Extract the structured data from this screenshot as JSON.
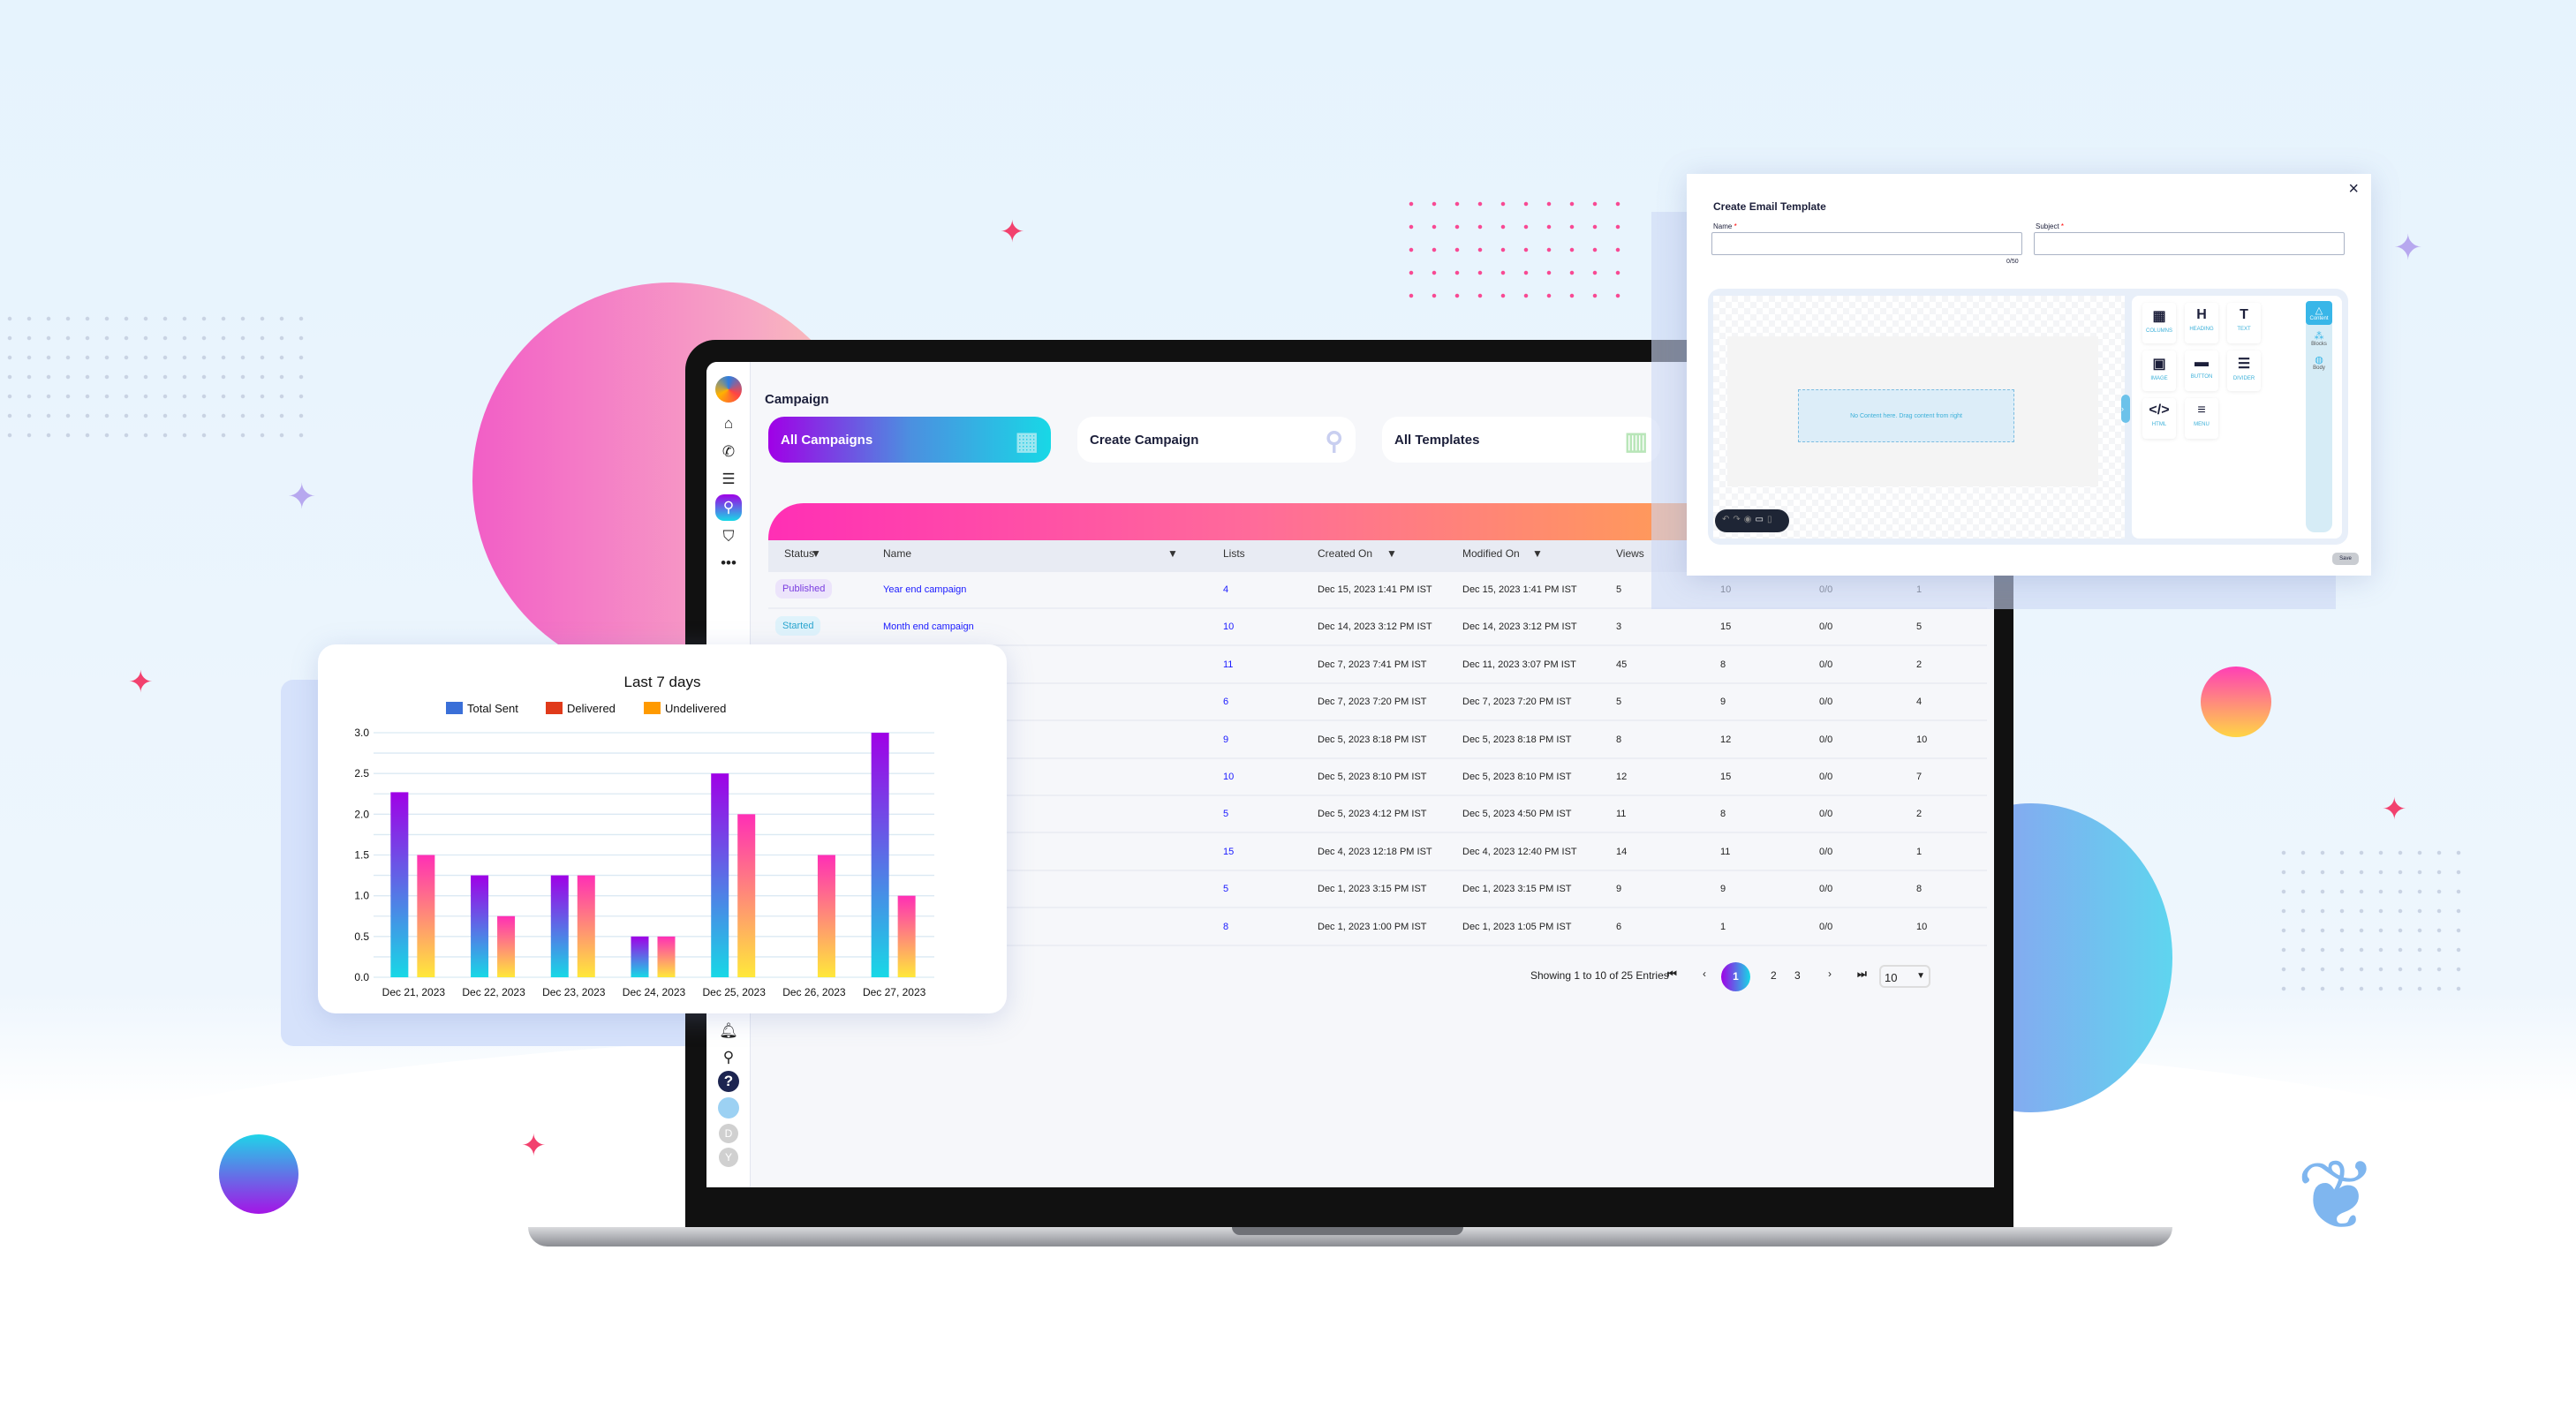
{
  "campaign": {
    "title": "Campaign",
    "cards": [
      {
        "label": "All Campaigns",
        "icon": "grid-icon"
      },
      {
        "label": "Create Campaign",
        "icon": "rocket-icon"
      },
      {
        "label": "All Templates",
        "icon": "template-icon"
      }
    ]
  },
  "table": {
    "headers": [
      "Status",
      "Name",
      "Lists",
      "Created On",
      "Modified On",
      "Views"
    ],
    "rows": [
      [
        "Published",
        "Year end campaign",
        "4",
        "Dec 15, 2023 1:41 PM IST",
        "Dec 15, 2023 1:41 PM IST",
        "5",
        "10",
        "0/0",
        "1"
      ],
      [
        "Started",
        "Month end campaign",
        "10",
        "Dec 14, 2023 3:12 PM IST",
        "Dec 14, 2023 3:12 PM IST",
        "3",
        "15",
        "0/0",
        "5"
      ],
      [
        "",
        "",
        "11",
        "Dec 7, 2023 7:41 PM IST",
        "Dec 11, 2023 3:07 PM IST",
        "45",
        "8",
        "0/0",
        "2"
      ],
      [
        "",
        "",
        "6",
        "Dec 7, 2023 7:20 PM IST",
        "Dec 7, 2023 7:20 PM IST",
        "5",
        "9",
        "0/0",
        "4"
      ],
      [
        "",
        "",
        "9",
        "Dec 5, 2023 8:18 PM IST",
        "Dec 5, 2023 8:18 PM IST",
        "8",
        "12",
        "0/0",
        "10"
      ],
      [
        "",
        "",
        "10",
        "Dec 5, 2023 8:10 PM IST",
        "Dec 5, 2023 8:10 PM IST",
        "12",
        "15",
        "0/0",
        "7"
      ],
      [
        "",
        "",
        "5",
        "Dec 5, 2023 4:12 PM IST",
        "Dec 5, 2023 4:50 PM IST",
        "11",
        "8",
        "0/0",
        "2"
      ],
      [
        "",
        "",
        "15",
        "Dec 4, 2023 12:18 PM IST",
        "Dec 4, 2023 12:40 PM IST",
        "14",
        "11",
        "0/0",
        "1"
      ],
      [
        "",
        "",
        "5",
        "Dec 1, 2023 3:15 PM IST",
        "Dec 1, 2023 3:15 PM IST",
        "9",
        "9",
        "0/0",
        "8"
      ],
      [
        "",
        "",
        "8",
        "Dec 1, 2023 1:00 PM IST",
        "Dec 1, 2023 1:05 PM IST",
        "6",
        "1",
        "0/0",
        "10"
      ]
    ]
  },
  "pagination": {
    "summary": "Showing 1 to 10 of 25 Entries",
    "pages": [
      "1",
      "2",
      "3"
    ],
    "current": "1",
    "page_size": "10"
  },
  "modal": {
    "title": "Create Email Template",
    "name_label": "Name",
    "subject_label": "Subject",
    "required": "*",
    "counter": "0/50",
    "close": "×",
    "placeholder_text": "No Content here. Drag content from right",
    "tools": [
      "COLUMNS",
      "HEADING",
      "TEXT",
      "IMAGE",
      "BUTTON",
      "DIVIDER",
      "HTML",
      "MENU"
    ],
    "tabs": [
      "Content",
      "Blocks",
      "Body"
    ],
    "save": "Save"
  },
  "sidebar_avatars": [
    "D",
    "Y"
  ],
  "colors": {
    "accent_purple": "#a000e6",
    "accent_cyan": "#18d8e6",
    "pink": "#ff2fb5",
    "orange": "#ffa24f",
    "link": "#1a1aff"
  },
  "chart_data": {
    "type": "bar",
    "title": "Last 7 days",
    "categories": [
      "Dec 21, 2023",
      "Dec 22, 2023",
      "Dec 23, 2023",
      "Dec 24, 2023",
      "Dec 25, 2023",
      "Dec 26, 2023",
      "Dec 27, 2023"
    ],
    "series": [
      {
        "name": "Total Sent",
        "color": "#3a6fd8",
        "values": [
          2.27,
          1.25,
          1.25,
          0.5,
          2.5,
          0,
          3.0
        ]
      },
      {
        "name": "Delivered",
        "color": "#e03a1a",
        "values": [
          1.5,
          0.75,
          1.25,
          0.5,
          2.0,
          1.5,
          1.0
        ]
      },
      {
        "name": "Undelivered",
        "color": "#ff9a00",
        "values": [
          0,
          0,
          0,
          0,
          0,
          0,
          0
        ]
      }
    ],
    "yticks": [
      "0.0",
      "0.5",
      "1.0",
      "1.5",
      "2.0",
      "2.5",
      "3.0"
    ],
    "ylim": [
      0,
      3
    ],
    "grid": true,
    "legend": "top"
  }
}
